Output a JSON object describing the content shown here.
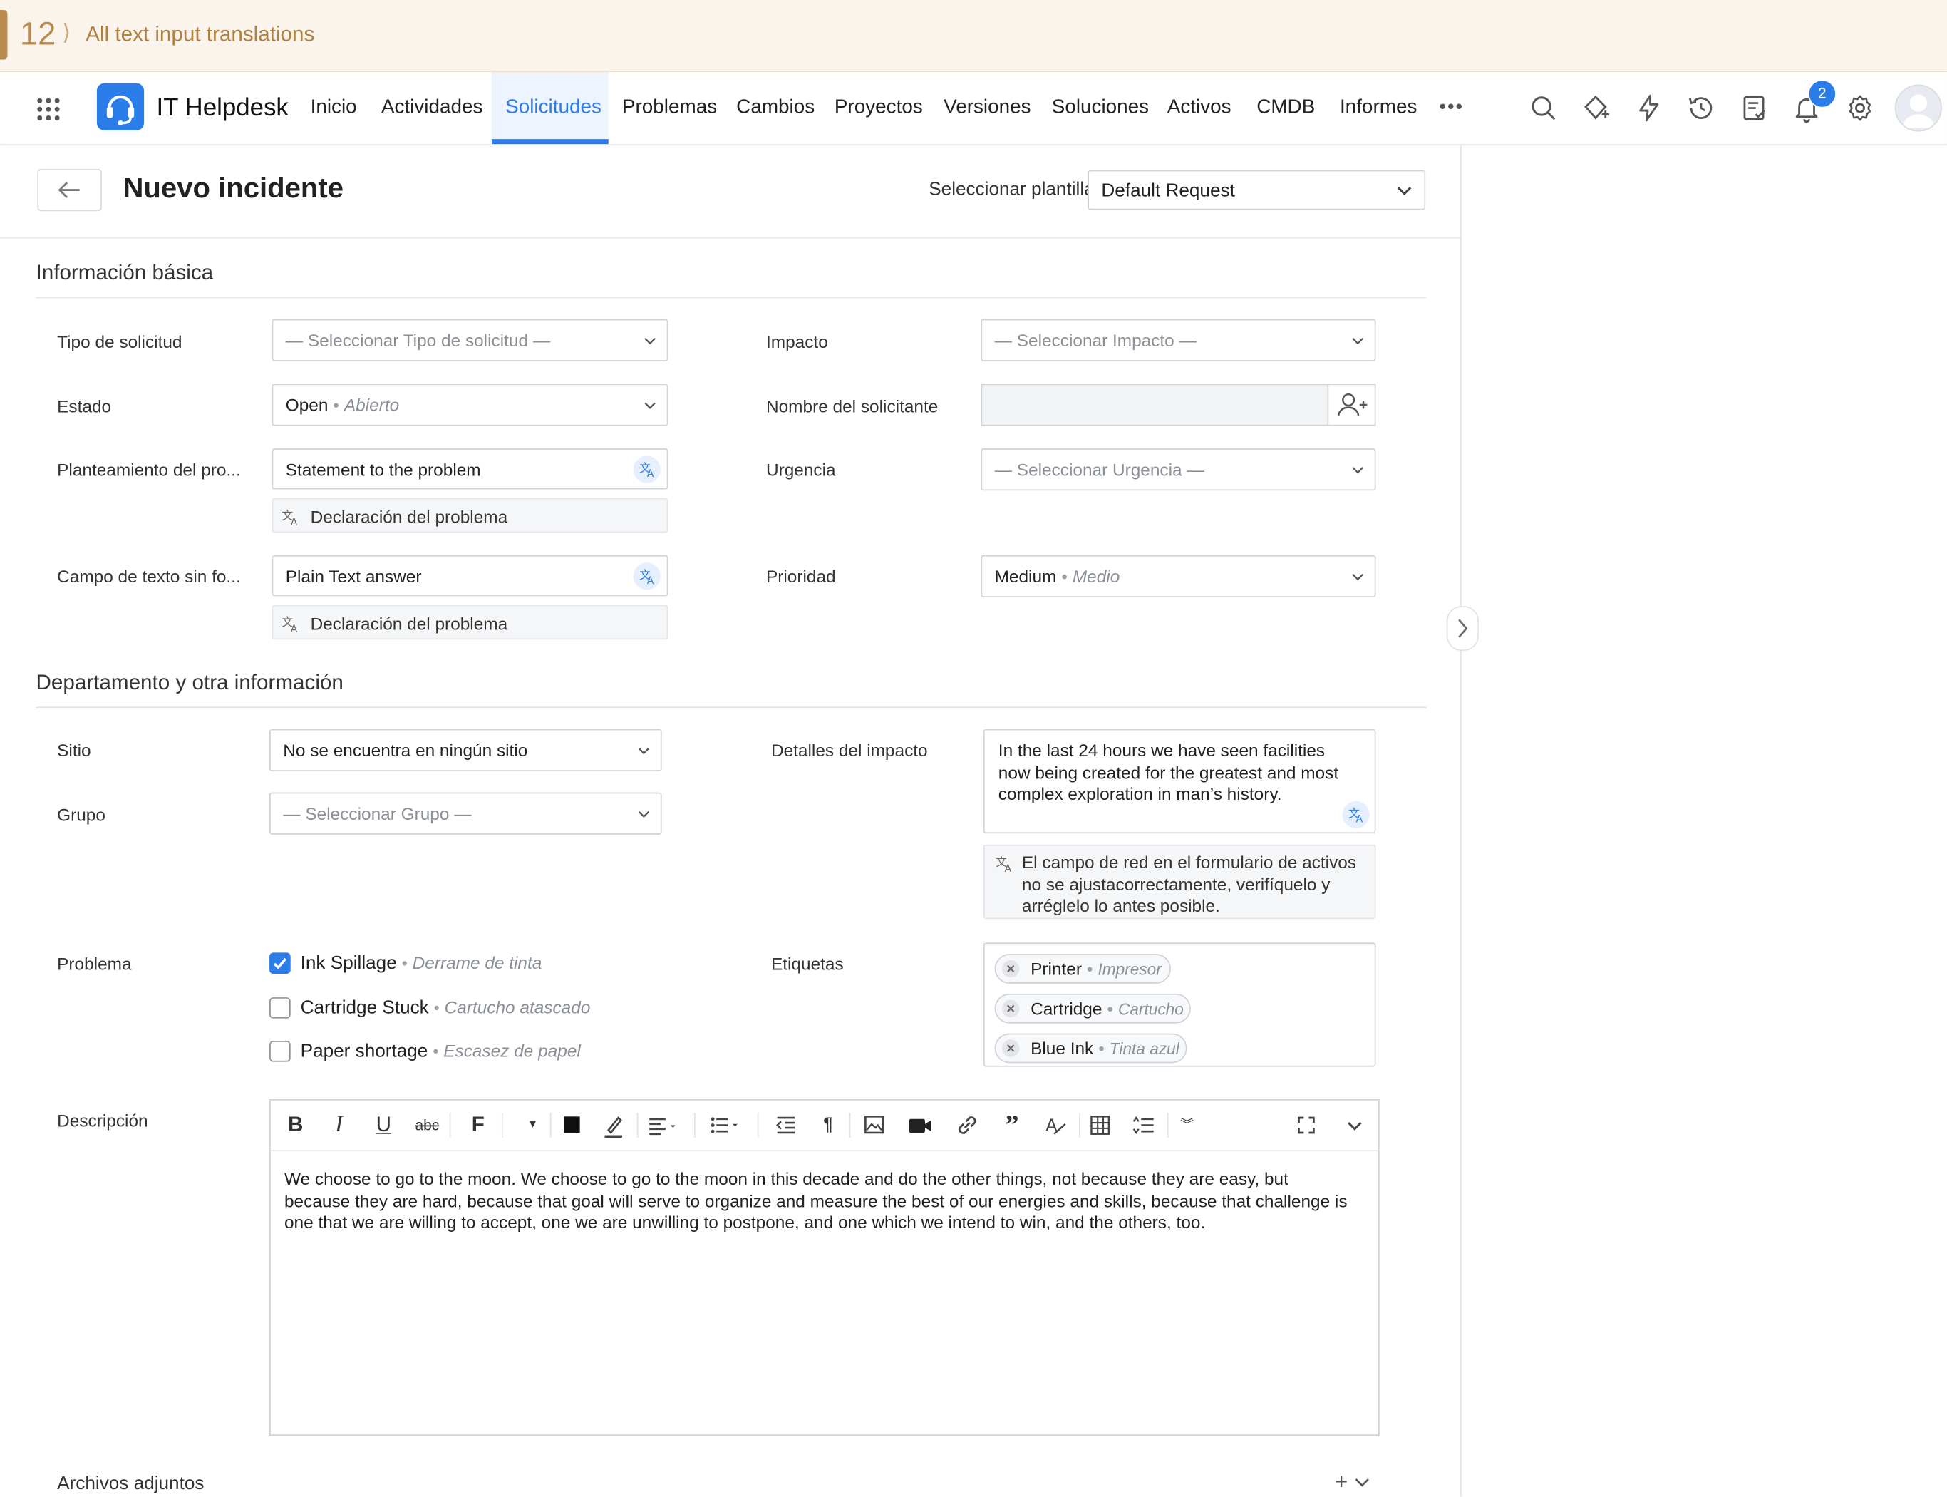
{
  "banner": {
    "number": "12",
    "title": "All text input translations"
  },
  "app": {
    "name": "IT Helpdesk"
  },
  "nav": {
    "items": [
      "Inicio",
      "Actividades",
      "Solicitudes",
      "Problemas",
      "Cambios",
      "Proyectos",
      "Versiones",
      "Soluciones",
      "Activos",
      "CMDB",
      "Informes"
    ],
    "active": "Solicitudes",
    "more": "•••",
    "notification_count": "2"
  },
  "header": {
    "title": "Nuevo incidente",
    "template_label": "Seleccionar plantilla",
    "template_value": "Default Request"
  },
  "basic": {
    "section_title": "Información básica",
    "request_type": {
      "label": "Tipo de solicitud",
      "placeholder": "— Seleccionar Tipo de solicitud —"
    },
    "status": {
      "label": "Estado",
      "value": "Open",
      "translation": "Abierto"
    },
    "problem_statement": {
      "label": "Planteamiento del pro...",
      "value": "Statement to the problem",
      "translation": "Declaración del problema"
    },
    "free_text": {
      "label": "Campo de texto sin fo...",
      "value": "Plain Text answer",
      "translation": "Declaración del problema"
    },
    "impact": {
      "label": "Impacto",
      "placeholder": "— Seleccionar Impacto —"
    },
    "requester": {
      "label": "Nombre del solicitante",
      "value": ""
    },
    "urgency": {
      "label": "Urgencia",
      "placeholder": "— Seleccionar Urgencia —"
    },
    "priority": {
      "label": "Prioridad",
      "value": "Medium",
      "translation": "Medio"
    }
  },
  "dept": {
    "section_title": "Departamento y otra información",
    "site": {
      "label": "Sitio",
      "value": "No se encuentra en ningún sitio"
    },
    "group": {
      "label": "Grupo",
      "placeholder": "— Seleccionar Grupo —"
    },
    "impact_details": {
      "label": "Detalles del impacto",
      "value": "In the last 24 hours we have seen facilities now being created for the greatest and most complex exploration in man’s history.",
      "translation": "El campo de red en el formulario de activos no se ajustacorrectamente, verifíquelo y arréglelo lo antes posible."
    },
    "problem": {
      "label": "Problema",
      "options": [
        {
          "label": "Ink Spillage",
          "translation": "Derrame de tinta",
          "checked": true
        },
        {
          "label": "Cartridge Stuck",
          "translation": "Cartucho atascado",
          "checked": false
        },
        {
          "label": "Paper shortage",
          "translation": "Escasez de papel",
          "checked": false
        }
      ]
    },
    "tags": {
      "label": "Etiquetas",
      "items": [
        {
          "label": "Printer",
          "translation": "Impresor"
        },
        {
          "label": "Cartridge",
          "translation": "Cartucho"
        },
        {
          "label": "Blue Ink",
          "translation": "Tinta azul"
        }
      ]
    }
  },
  "description": {
    "label": "Descripción",
    "text": "We choose to go to the moon. We choose to go to the moon in this decade and do the other things, not because they are easy, but because they are hard, because that goal will serve to organize and measure the best of our energies and skills, because that challenge is one that we are willing to accept, one we are unwilling to postpone, and one which we intend to win, and the others, too."
  },
  "attachments": {
    "label": "Archivos adjuntos",
    "add": "+"
  },
  "colors": {
    "accent": "#2b7de9",
    "banner_bg": "#fbf4ec",
    "banner_text": "#b0803e"
  }
}
